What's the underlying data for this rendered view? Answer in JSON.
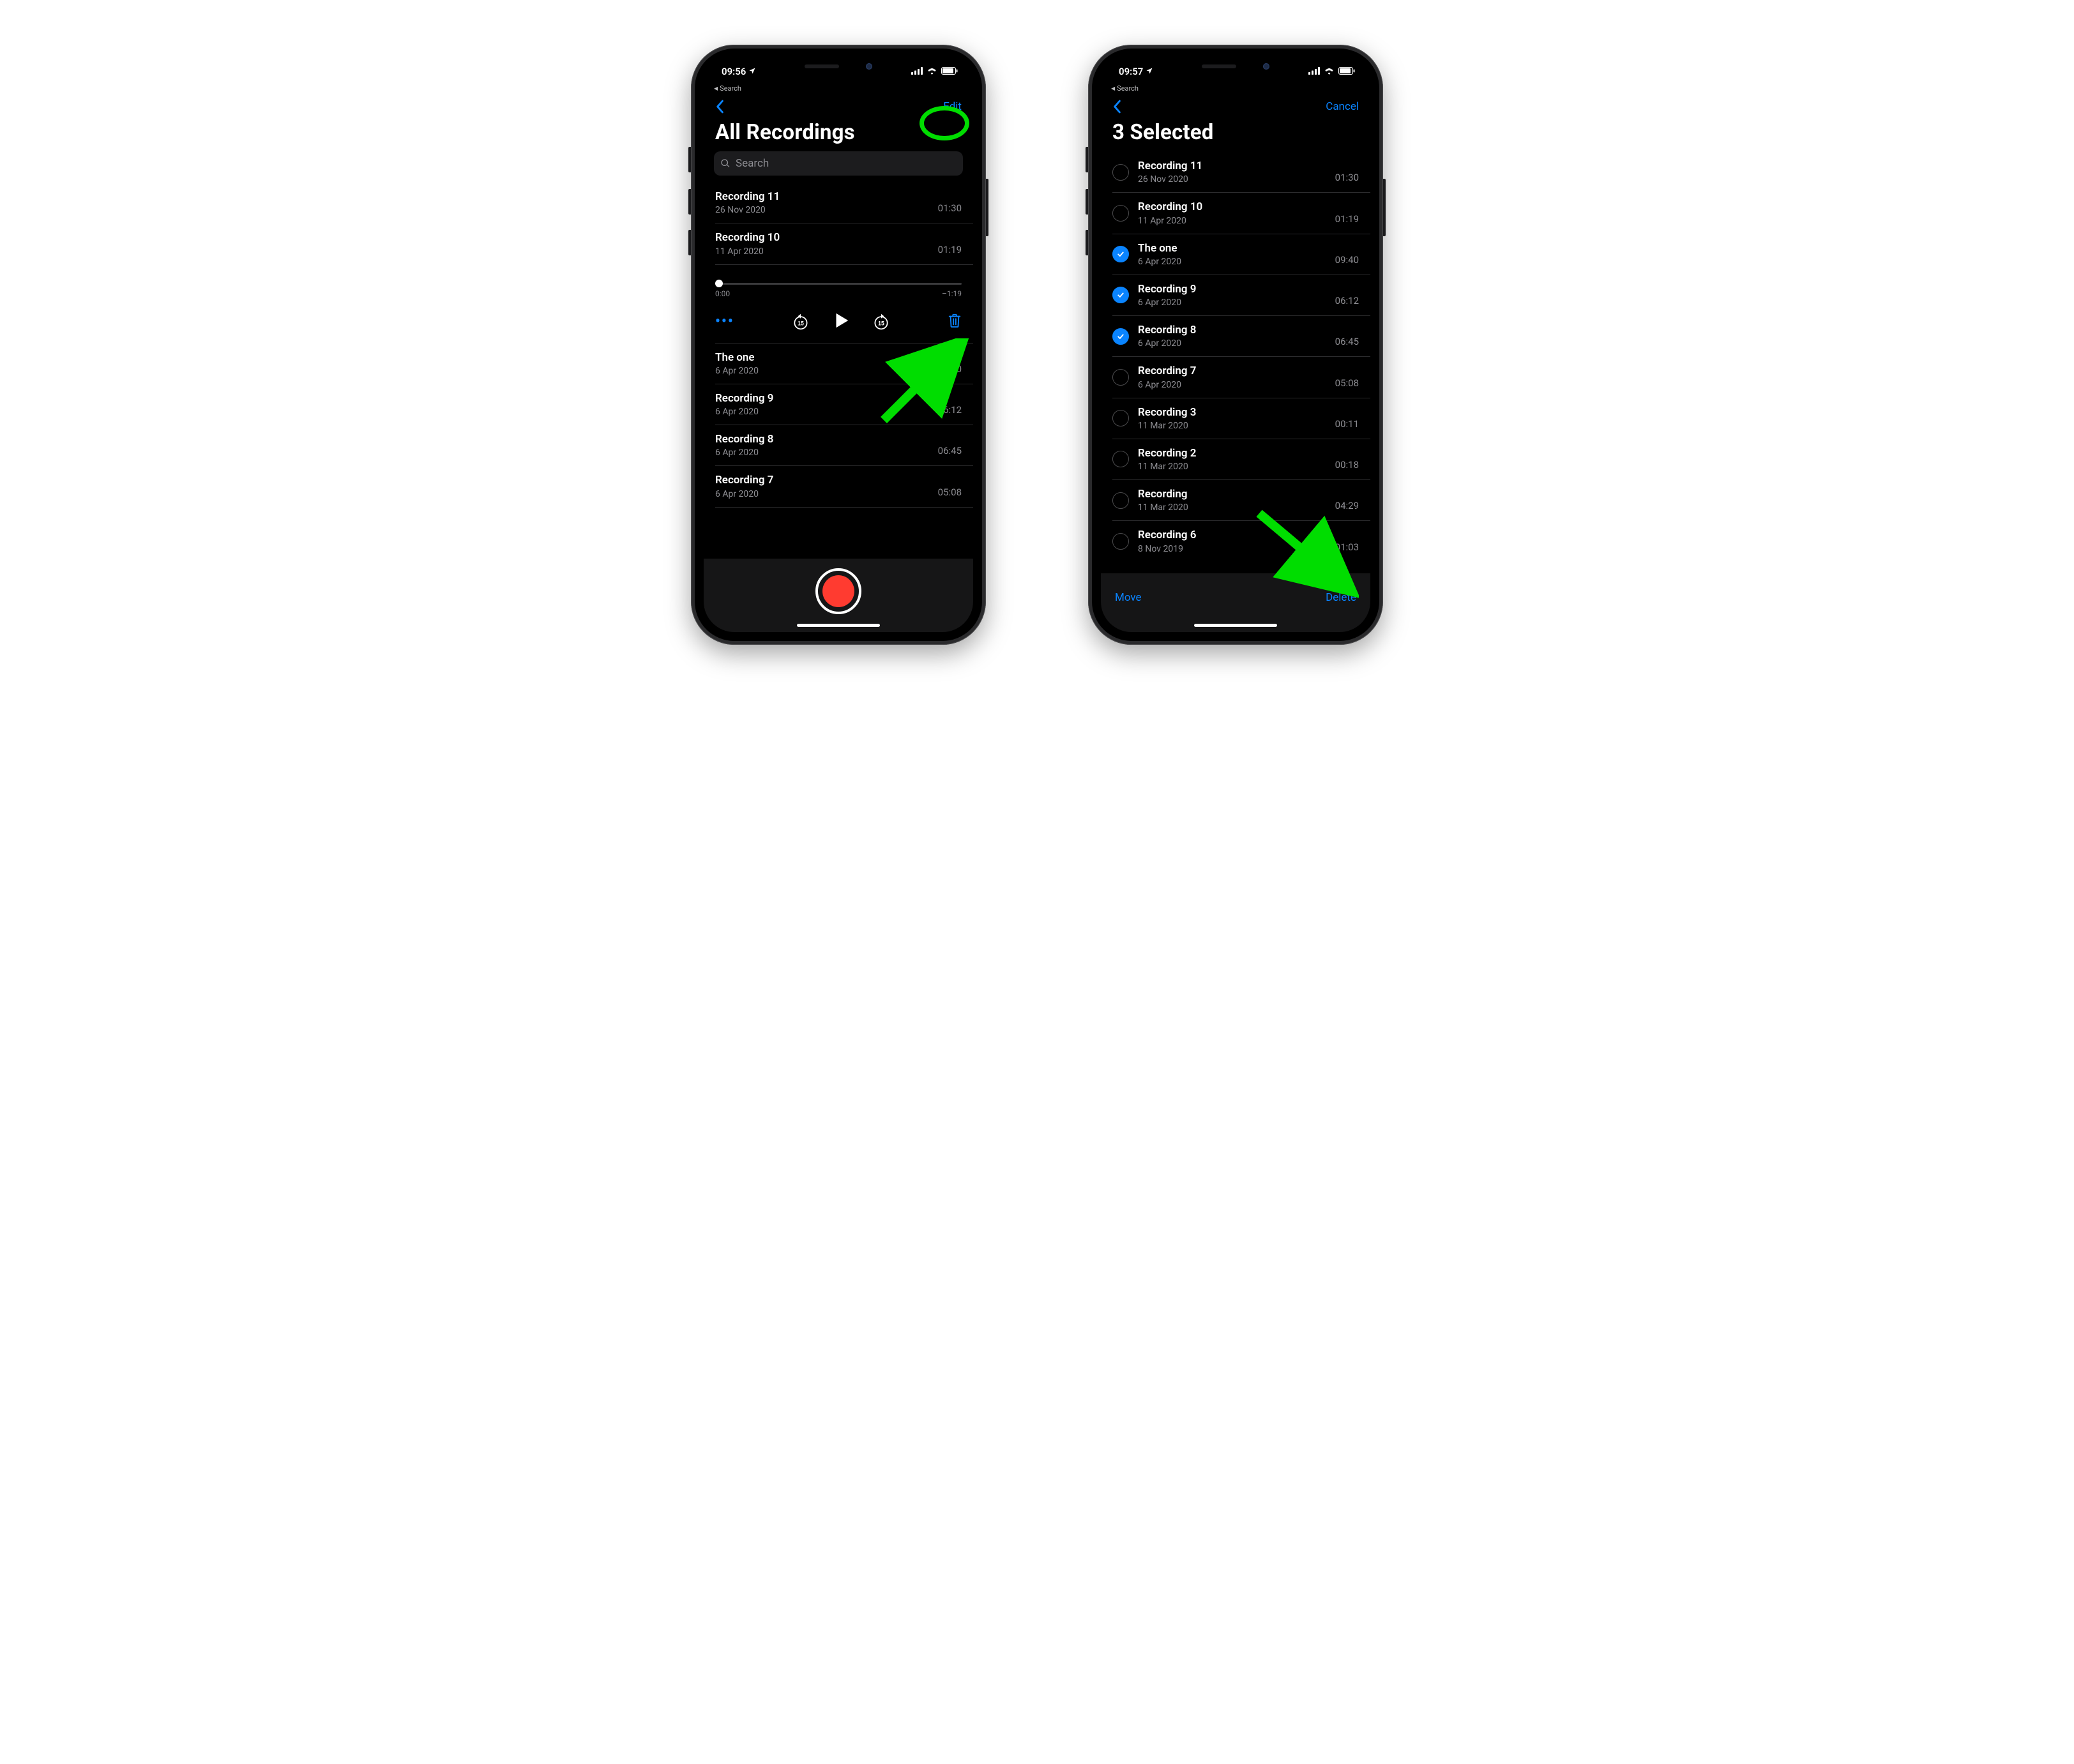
{
  "left": {
    "status": {
      "time": "09:56",
      "back_app": "Search"
    },
    "nav": {
      "edit": "Edit"
    },
    "title": "All Recordings",
    "search_placeholder": "Search",
    "recordings": [
      {
        "title": "Recording 11",
        "date": "26 Nov 2020",
        "dur": "01:30"
      },
      {
        "title": "Recording 10",
        "date": "11 Apr 2020",
        "dur": "01:19"
      }
    ],
    "player": {
      "elapsed": "0:00",
      "remaining": "–1:19"
    },
    "recordings_after": [
      {
        "title": "The one",
        "date": "6 Apr 2020",
        "dur": "09:40"
      },
      {
        "title": "Recording 9",
        "date": "6 Apr 2020",
        "dur": "06:12"
      },
      {
        "title": "Recording 8",
        "date": "6 Apr 2020",
        "dur": "06:45"
      },
      {
        "title": "Recording 7",
        "date": "6 Apr 2020",
        "dur": "05:08"
      }
    ]
  },
  "right": {
    "status": {
      "time": "09:57",
      "back_app": "Search"
    },
    "nav": {
      "cancel": "Cancel"
    },
    "title": "3 Selected",
    "recordings": [
      {
        "title": "Recording 11",
        "date": "26 Nov 2020",
        "dur": "01:30",
        "selected": false
      },
      {
        "title": "Recording 10",
        "date": "11 Apr 2020",
        "dur": "01:19",
        "selected": false
      },
      {
        "title": "The one",
        "date": "6 Apr 2020",
        "dur": "09:40",
        "selected": true
      },
      {
        "title": "Recording 9",
        "date": "6 Apr 2020",
        "dur": "06:12",
        "selected": true
      },
      {
        "title": "Recording 8",
        "date": "6 Apr 2020",
        "dur": "06:45",
        "selected": true
      },
      {
        "title": "Recording 7",
        "date": "6 Apr 2020",
        "dur": "05:08",
        "selected": false
      },
      {
        "title": "Recording 3",
        "date": "11 Mar 2020",
        "dur": "00:11",
        "selected": false
      },
      {
        "title": "Recording 2",
        "date": "11 Mar 2020",
        "dur": "00:18",
        "selected": false
      },
      {
        "title": "Recording",
        "date": "11 Mar 2020",
        "dur": "04:29",
        "selected": false
      },
      {
        "title": "Recording 6",
        "date": "8 Nov 2019",
        "dur": "01:03",
        "selected": false
      }
    ],
    "actions": {
      "move": "Move",
      "delete": "Delete"
    }
  },
  "icons": {
    "skip": "15"
  }
}
